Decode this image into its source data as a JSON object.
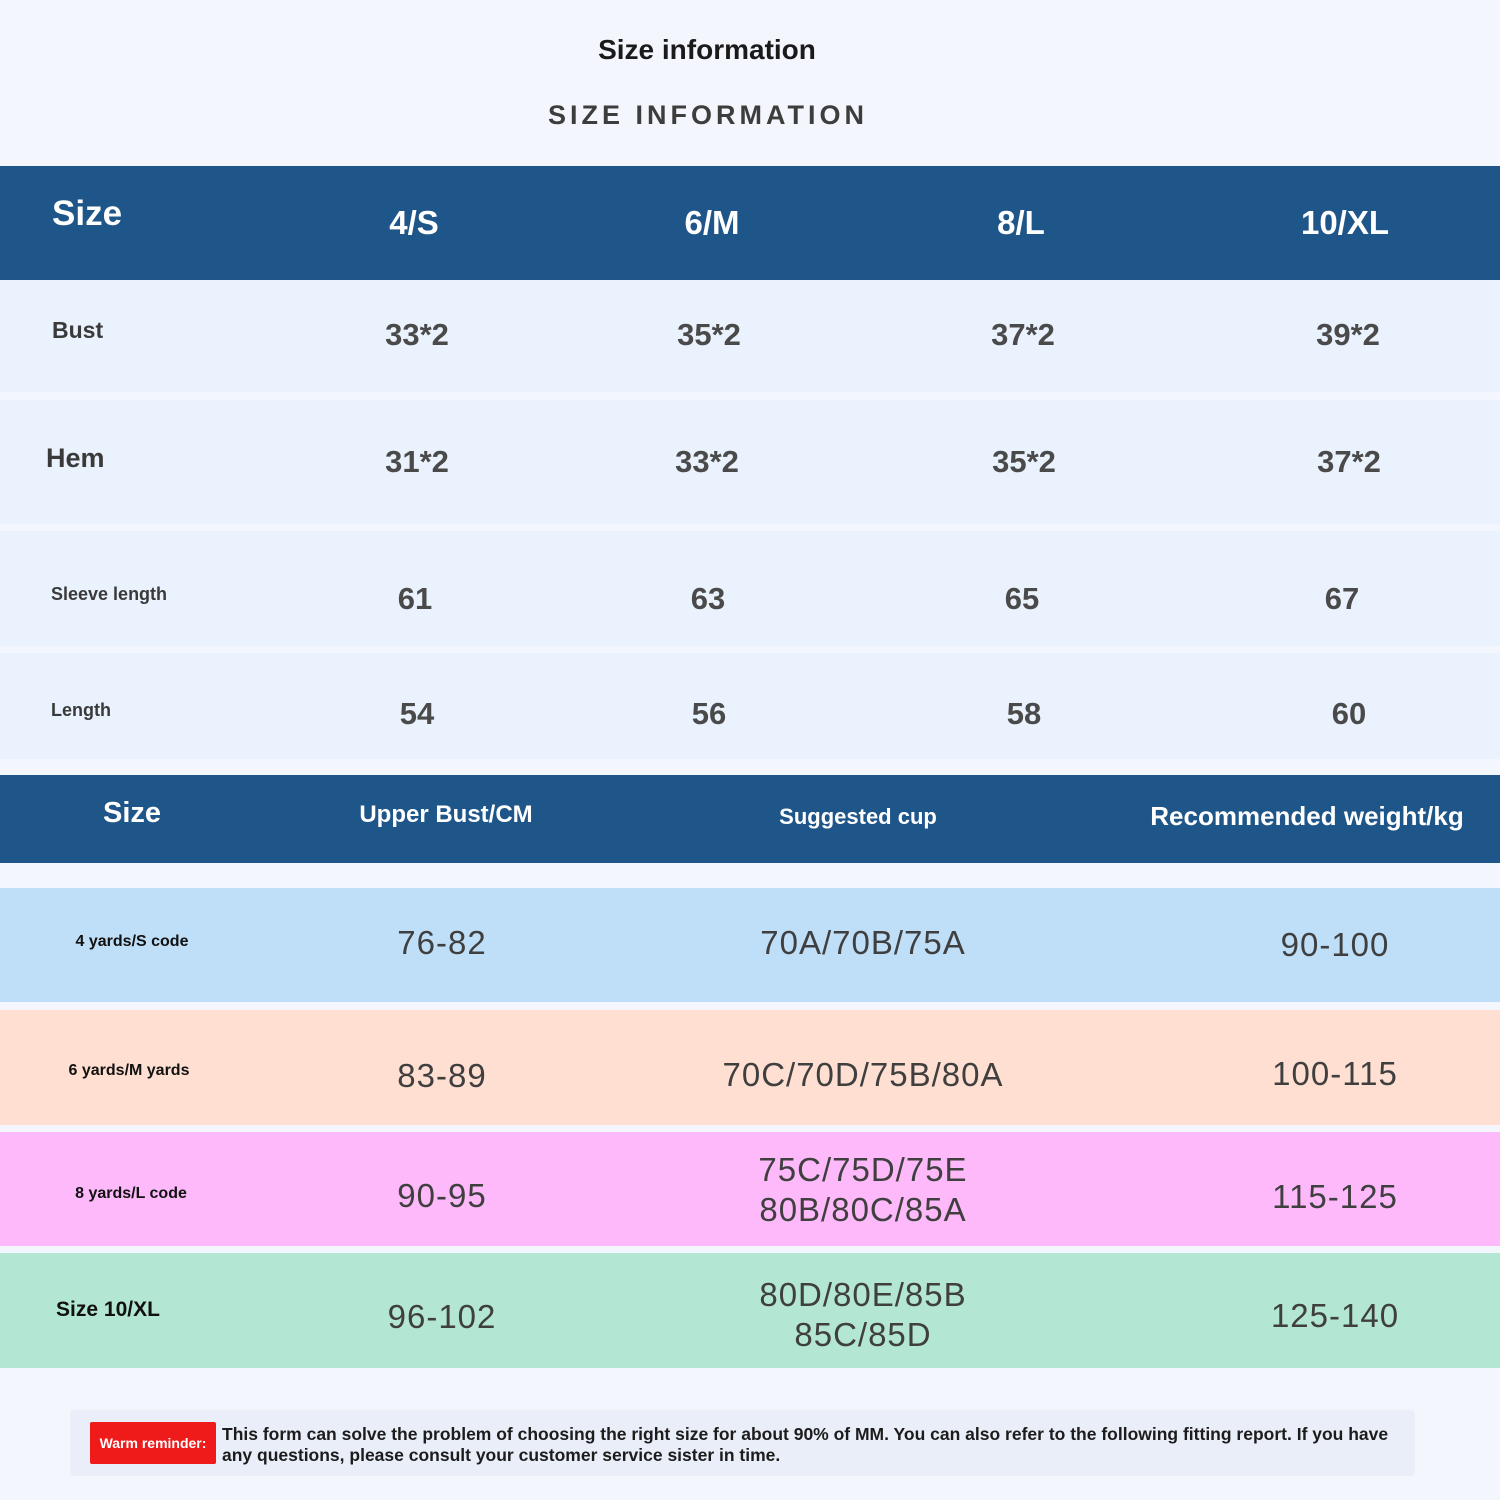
{
  "heading": {
    "title": "Size information",
    "subtitle": "SIZE INFORMATION"
  },
  "colors": {
    "header_band": "#1f5689",
    "measure_row_bg": "#e9f2fd",
    "row_s_bg": "#bfdef7",
    "row_m_bg": "#ffdfd2",
    "row_l_bg": "#fdb9f9",
    "row_xl_bg": "#b3e7d3",
    "badge_bg": "#ef1a1a"
  },
  "measurements": {
    "header": [
      "Size",
      "4/S",
      "6/M",
      "8/L",
      "10/XL"
    ],
    "rows": [
      {
        "label": "Bust",
        "values": [
          "33*2",
          "35*2",
          "37*2",
          "39*2"
        ]
      },
      {
        "label": "Hem",
        "values": [
          "31*2",
          "33*2",
          "35*2",
          "37*2"
        ]
      },
      {
        "label": "Sleeve length",
        "values": [
          "61",
          "63",
          "65",
          "67"
        ]
      },
      {
        "label": "Length",
        "values": [
          "54",
          "56",
          "58",
          "60"
        ]
      }
    ]
  },
  "recommendation": {
    "header": [
      "Size",
      "Upper Bust/CM",
      "Suggested cup",
      "Recommended weight/kg"
    ],
    "rows": [
      {
        "label": "4 yards/S code",
        "bust": "76-82",
        "cup_line1": "70A/70B/75A",
        "cup_line2": "",
        "weight": "90-100"
      },
      {
        "label": "6 yards/M yards",
        "bust": "83-89",
        "cup_line1": "70C/70D/75B/80A",
        "cup_line2": "",
        "weight": "100-115"
      },
      {
        "label": "8 yards/L code",
        "bust": "90-95",
        "cup_line1": "75C/75D/75E",
        "cup_line2": "80B/80C/85A",
        "weight": "115-125"
      },
      {
        "label": "Size 10/XL",
        "bust": "96-102",
        "cup_line1": "80D/80E/85B",
        "cup_line2": "85C/85D",
        "weight": "125-140"
      }
    ]
  },
  "notice": {
    "badge": "Warm reminder:",
    "text": "This form can solve the problem of choosing the right size for about 90% of MM. You can also refer to the following fitting report. If you have any questions, please consult your customer service sister in time."
  }
}
